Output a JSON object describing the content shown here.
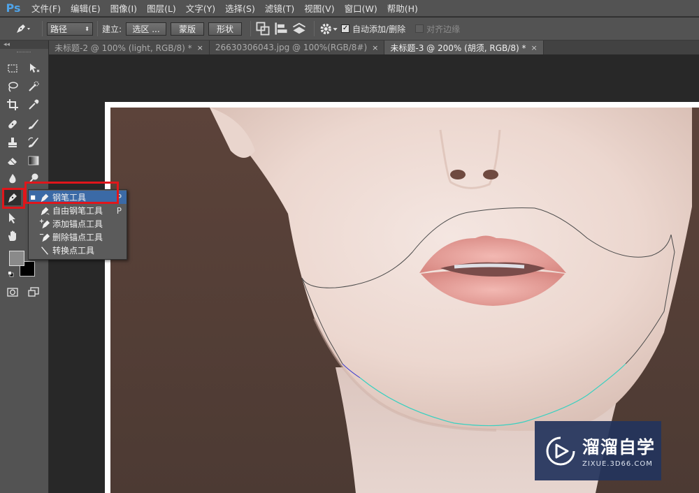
{
  "app": {
    "logo": "Ps"
  },
  "menu": [
    "文件(F)",
    "编辑(E)",
    "图像(I)",
    "图层(L)",
    "文字(Y)",
    "选择(S)",
    "滤镜(T)",
    "视图(V)",
    "窗口(W)",
    "帮助(H)"
  ],
  "options_bar": {
    "tool_icon": "pen-icon",
    "mode_value": "路径",
    "build_label": "建立:",
    "selection_button": "选区 ...",
    "mask_button": "蒙版",
    "shape_button": "形状",
    "auto_add_delete_label": "自动添加/删除",
    "auto_add_delete_checked": true,
    "align_edges_label": "对齐边缘",
    "align_edges_checked": false
  },
  "tabs": [
    {
      "title": "未标题-2 @ 100% (light, RGB/8) *",
      "active": false,
      "close": "×"
    },
    {
      "title": "26630306043.jpg @ 100%(RGB/8#)",
      "active": false,
      "close": "×"
    },
    {
      "title": "未标题-3 @ 200% (胡须, RGB/8) *",
      "active": true,
      "close": "×"
    }
  ],
  "toolbox": {
    "collapse": "◂◂",
    "selected_tool": "pen-tool",
    "foreground_color": "#8a8a8a",
    "background_color": "#000000"
  },
  "flyout": {
    "items": [
      {
        "label": "钢笔工具",
        "shortcut": "P",
        "selected": true,
        "icon": "pen-icon"
      },
      {
        "label": "自由钢笔工具",
        "shortcut": "P",
        "selected": false,
        "icon": "freeform-pen-icon"
      },
      {
        "label": "添加锚点工具",
        "shortcut": "",
        "selected": false,
        "icon": "add-anchor-icon"
      },
      {
        "label": "删除锚点工具",
        "shortcut": "",
        "selected": false,
        "icon": "delete-anchor-icon"
      },
      {
        "label": "转换点工具",
        "shortcut": "",
        "selected": false,
        "icon": "convert-point-icon"
      }
    ]
  },
  "watermark": {
    "title": "溜溜自学",
    "url": "ZIXUE.3D66.COM"
  },
  "colors": {
    "accent": "#3b6aa6",
    "highlight_box": "#e0161b",
    "path_selected": "#39d0c0"
  }
}
